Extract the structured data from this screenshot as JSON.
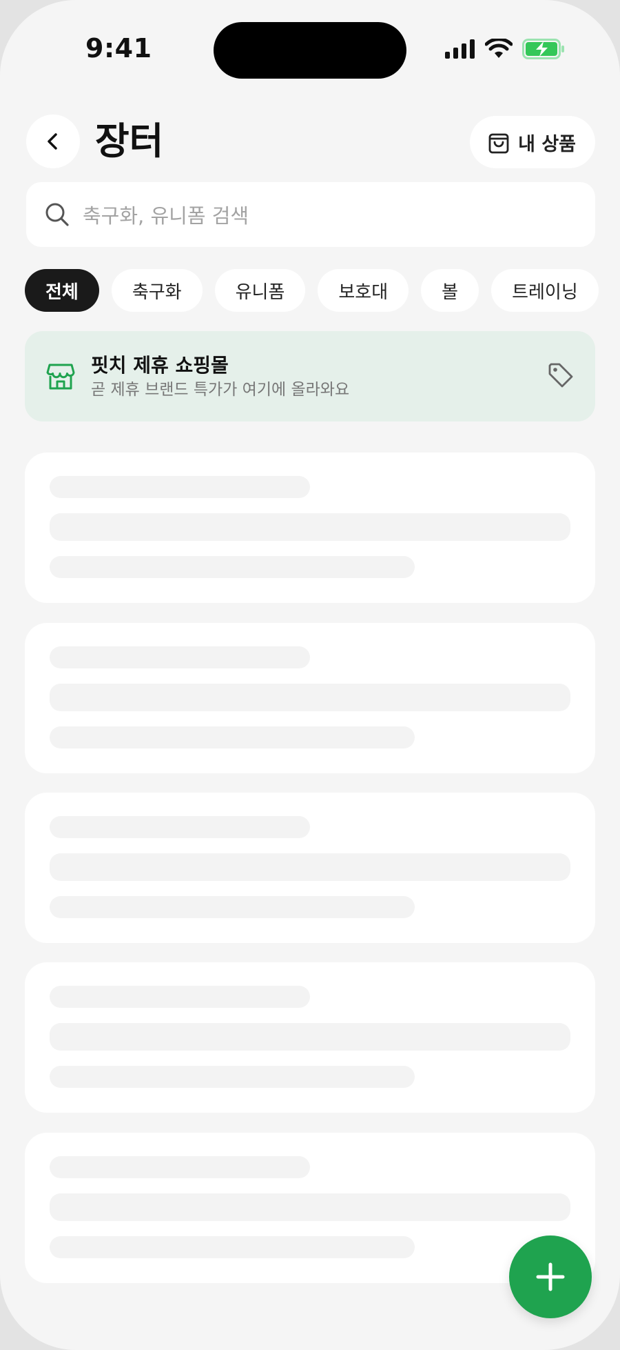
{
  "status_bar": {
    "time": "9:41"
  },
  "header": {
    "title": "장터",
    "my_products_label": "내 상품"
  },
  "search": {
    "placeholder": "축구화, 유니폼 검색"
  },
  "categories": [
    "전체",
    "축구화",
    "유니폼",
    "보호대",
    "볼",
    "트레이닝"
  ],
  "selected_category": "전체",
  "promo": {
    "title": "핏치 제휴 쇼핑몰",
    "subtitle": "곧 제휴 브랜드 특가가 여기에 올라와요"
  },
  "icons": {
    "back": "chevron-left-icon",
    "bag": "shopping-bag-icon",
    "search": "search-icon",
    "store": "store-icon",
    "tag": "tag-icon",
    "add": "plus-icon"
  },
  "colors": {
    "accent": "#1fa34f",
    "promo_bg": "#e5f0ea",
    "chip_active": "#1a1a1a",
    "battery": "#34c759"
  }
}
